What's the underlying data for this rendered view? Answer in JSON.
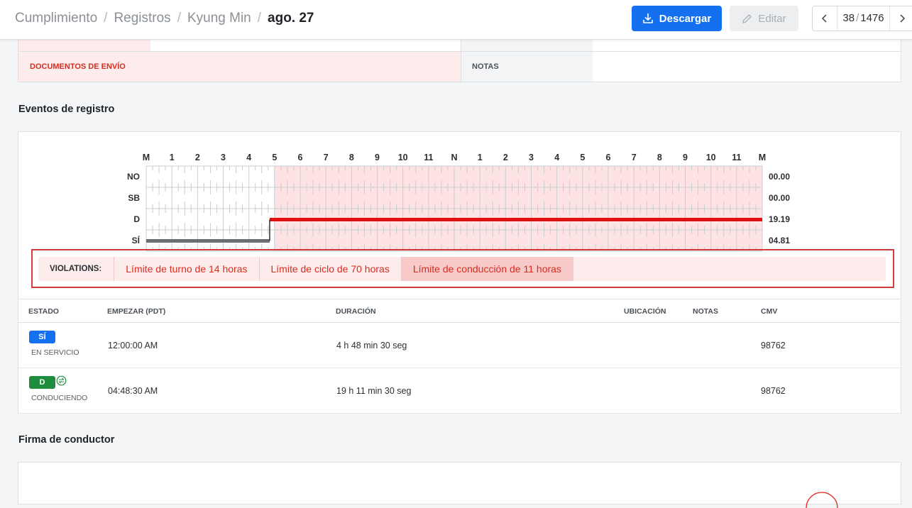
{
  "breadcrumb": {
    "items": [
      "Cumplimiento",
      "Registros",
      "Kyung Min"
    ],
    "separator": "/",
    "current": "ago. 27"
  },
  "toolbar": {
    "download_label": "Descargar",
    "edit_label": "Editar",
    "pager_current": "38",
    "pager_separator": "/",
    "pager_total": "1476"
  },
  "documents": {
    "shipping_label": "DOCUMENTOS DE ENVÍO",
    "notes_label": "NOTAS"
  },
  "events_section": {
    "title": "Eventos de registro"
  },
  "chart_data": {
    "type": "log-grid",
    "hour_labels": [
      "M",
      "1",
      "2",
      "3",
      "4",
      "5",
      "6",
      "7",
      "8",
      "9",
      "10",
      "11",
      "N",
      "1",
      "2",
      "3",
      "4",
      "5",
      "6",
      "7",
      "8",
      "9",
      "10",
      "11",
      "M"
    ],
    "rows": [
      {
        "label": "NO",
        "total": "00.00"
      },
      {
        "label": "SB",
        "total": "00.00"
      },
      {
        "label": "D",
        "total": "19.19"
      },
      {
        "label": "SÍ",
        "total": "04.81"
      }
    ],
    "segments": [
      {
        "row": "SÍ",
        "start_hour": 0.0,
        "end_hour": 4.81,
        "color": "#6b6f74"
      },
      {
        "row": "D",
        "start_hour": 4.81,
        "end_hour": 24.0,
        "color": "#e01010"
      }
    ],
    "violation_start_hour": 5.0,
    "colors": {
      "violation_fill": "#fde3e3",
      "grid": "#c9cdd2"
    }
  },
  "violations": {
    "label": "VIOLATIONS:",
    "items": [
      {
        "text": "Límite de turno de 14 horas",
        "selected": false
      },
      {
        "text": "Límite de ciclo de 70 horas",
        "selected": false
      },
      {
        "text": "Límite de conducción de 11 horas",
        "selected": true
      }
    ]
  },
  "table": {
    "headers": {
      "status": "ESTADO",
      "start": "EMPEZAR (PDT)",
      "duration": "DURACIÓN",
      "location": "UBICACIÓN",
      "notes": "NOTAS",
      "cmv": "CMV"
    },
    "rows": [
      {
        "badge": "SÍ",
        "badge_color": "#1570ef",
        "status": "EN SERVICIO",
        "start": "12:00:00 AM",
        "duration": "4 h 48 min 30 seg",
        "cmv": "98762"
      },
      {
        "badge": "D",
        "badge_color": "#1e8e3e",
        "status": "CONDUCIENDO",
        "start": "04:48:30 AM",
        "duration": "19 h 11 min 30 seg",
        "cmv": "98762"
      }
    ]
  },
  "signature_section": {
    "title": "Firma de conductor"
  }
}
